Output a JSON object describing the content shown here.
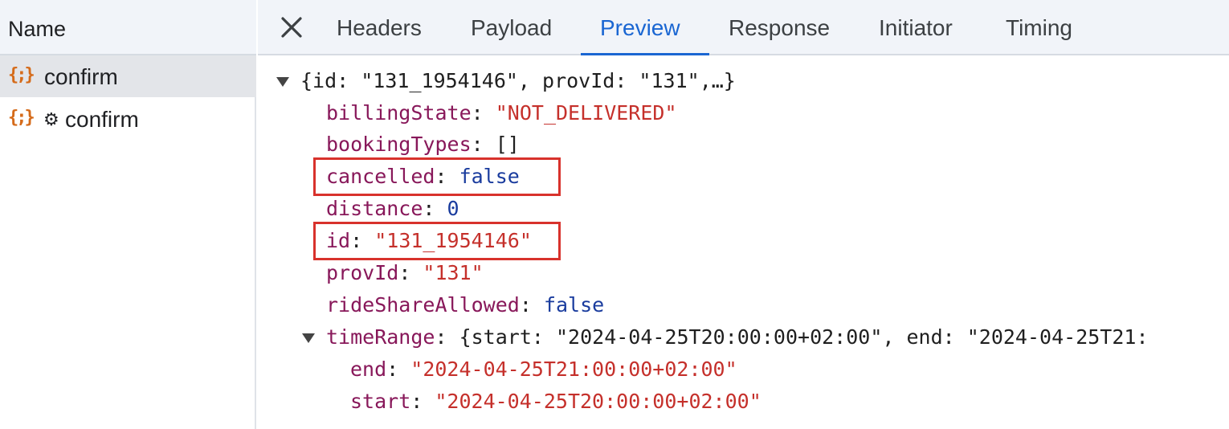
{
  "request_list": {
    "header": "Name",
    "items": [
      {
        "icon": "json-braces-icon",
        "label": "confirm",
        "selected": true
      },
      {
        "icon": "json-braces-icon",
        "gear": "⚙",
        "label": "confirm",
        "selected": false
      }
    ]
  },
  "tabs": {
    "close_symbol": "close-icon",
    "items": [
      "Headers",
      "Payload",
      "Preview",
      "Response",
      "Initiator",
      "Timing"
    ],
    "active": "Preview"
  },
  "preview": {
    "root_summary": "{id: \"131_1954146\", provId: \"131\",…}",
    "fields": [
      {
        "key": "billingState",
        "value": "\"NOT_DELIVERED\"",
        "type": "string"
      },
      {
        "key": "bookingTypes",
        "value": "[]",
        "type": "plain"
      },
      {
        "key": "cancelled",
        "value": "false",
        "type": "bool",
        "highlighted": true
      },
      {
        "key": "distance",
        "value": "0",
        "type": "number"
      },
      {
        "key": "id",
        "value": "\"131_1954146\"",
        "type": "string",
        "highlighted": true
      },
      {
        "key": "provId",
        "value": "\"131\"",
        "type": "string"
      },
      {
        "key": "rideShareAllowed",
        "value": "false",
        "type": "bool"
      }
    ],
    "timeRange": {
      "key": "timeRange",
      "summary": "{start: \"2024-04-25T20:00:00+02:00\", end: \"2024-04-25T21:",
      "children": [
        {
          "key": "end",
          "value": "\"2024-04-25T21:00:00+02:00\""
        },
        {
          "key": "start",
          "value": "\"2024-04-25T20:00:00+02:00\""
        }
      ]
    },
    "highlight_color": "#d8322c"
  },
  "colors": {
    "accent": "#1a66d2",
    "json_key": "#88185a",
    "json_string": "#c5302b",
    "json_literal": "#1a3c9e",
    "request_icon": "#d56b1a"
  }
}
